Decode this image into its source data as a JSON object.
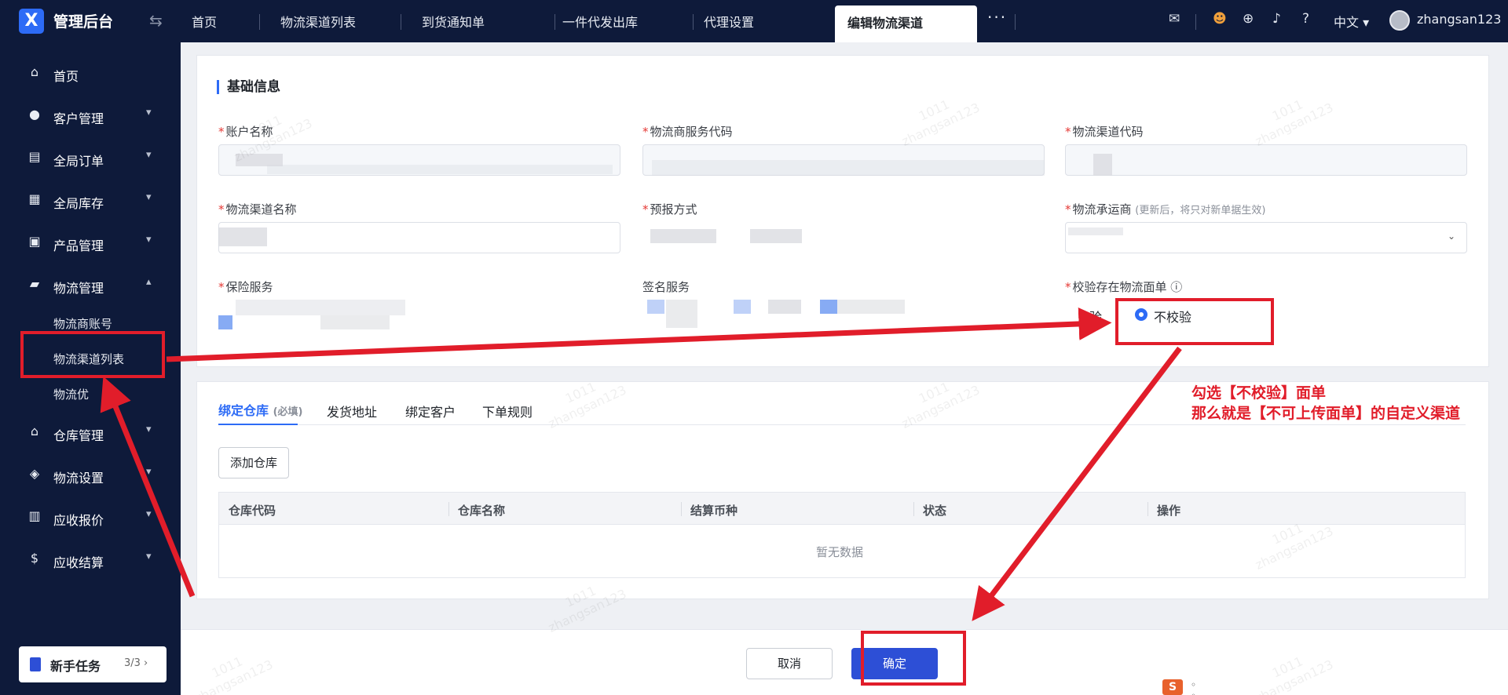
{
  "header": {
    "logo_glyph": "X",
    "brand": "管理后台",
    "tabs": [
      "首页",
      "物流渠道列表",
      "到货通知单",
      "一件代发出库",
      "代理设置",
      "编辑物流渠道"
    ],
    "more": "···",
    "language": "中文",
    "username": "zhangsan123"
  },
  "sidebar": {
    "items": [
      {
        "label": "首页",
        "icon": "home-icon"
      },
      {
        "label": "客户管理",
        "icon": "users-icon"
      },
      {
        "label": "全局订单",
        "icon": "order-icon"
      },
      {
        "label": "全局库存",
        "icon": "warehouse-icon"
      },
      {
        "label": "产品管理",
        "icon": "bag-icon"
      },
      {
        "label": "物流管理",
        "icon": "truck-icon"
      },
      {
        "label": "仓库管理",
        "icon": "building-icon"
      },
      {
        "label": "物流设置",
        "icon": "box-icon"
      },
      {
        "label": "应收报价",
        "icon": "doc-icon"
      },
      {
        "label": "应收结算",
        "icon": "coin-icon"
      }
    ],
    "logistics_sub": [
      "物流商账号",
      "物流渠道列表",
      "物流优"
    ],
    "task_label": "新手任务",
    "task_count": "3/3"
  },
  "form": {
    "section_title": "基础信息",
    "labels": {
      "account_name": "账户名称",
      "provider_code": "物流商服务代码",
      "channel_code": "物流渠道代码",
      "channel_name": "物流渠道名称",
      "forecast": "预报方式",
      "carrier": "物流承运商",
      "carrier_hint": "(更新后，将只对新单据生效)",
      "insurance": "保险服务",
      "signature": "签名服务",
      "verify": "校验存在物流面单"
    },
    "verify_prefix": "验",
    "verify_option": "不校验",
    "verify_selected": "不校验"
  },
  "tabs": {
    "bind_warehouse": "绑定仓库",
    "required_hint": "(必填)",
    "ship_address": "发货地址",
    "bind_customer": "绑定客户",
    "order_rules": "下单规则"
  },
  "table": {
    "add_button": "添加仓库",
    "headers": [
      "仓库代码",
      "仓库名称",
      "结算币种",
      "状态",
      "操作"
    ],
    "empty": "暂无数据"
  },
  "footer": {
    "cancel": "取消",
    "confirm": "确定"
  },
  "annotation": {
    "line1": "勾选【不校验】面单",
    "line2": "那么就是【不可上传面单】的自定义渠道"
  },
  "watermark": {
    "line1": "1011",
    "line2": "zhangsan123"
  },
  "colors": {
    "accent": "#2d6bf6",
    "annotation": "#e11d2a",
    "nav_bg": "#0e1a3a"
  }
}
